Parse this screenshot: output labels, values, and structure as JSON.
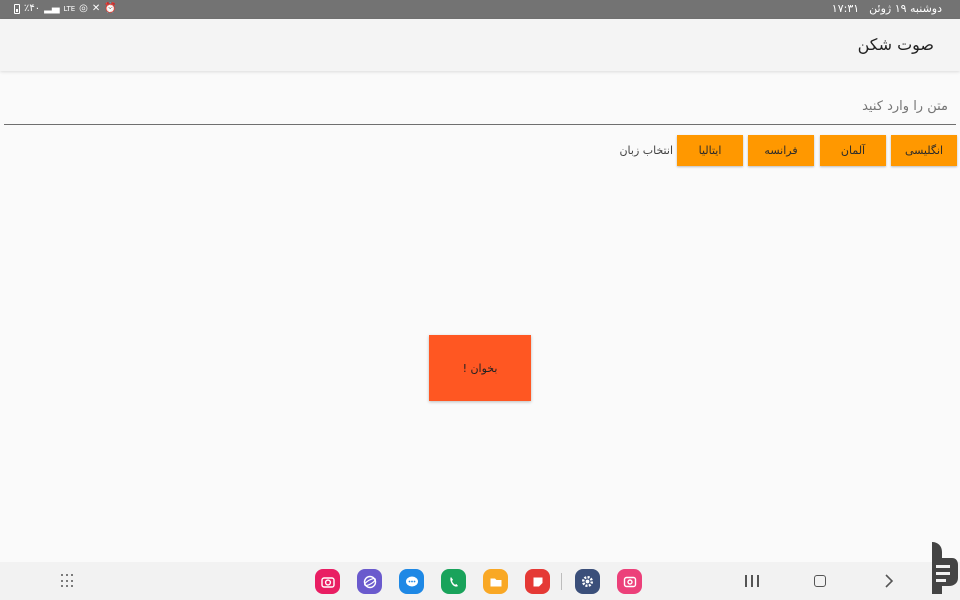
{
  "status_bar": {
    "date_text": "دوشنبه ۱۹ ژوئن",
    "time": "۱۷:۳۱",
    "battery_text": "٪۴۰"
  },
  "app": {
    "title": "صوت شکن"
  },
  "input": {
    "placeholder": "متن را وارد کنید",
    "value": ""
  },
  "languages": {
    "label": "انتخاب زبان",
    "buttons": [
      "انگلیسی",
      "آلمان",
      "فرانسه",
      "ایتالیا"
    ]
  },
  "read_button": {
    "label": "بخوان !"
  },
  "colors": {
    "language_button": "#ff9800",
    "read_button": "#ff5722",
    "status_bar": "#737373"
  },
  "taskbar": {
    "dock_apps": [
      "camera-icon",
      "internet-icon",
      "messages-icon",
      "phone-icon",
      "my-files-icon",
      "notes-icon",
      "settings-icon",
      "screen-recorder-icon"
    ]
  }
}
